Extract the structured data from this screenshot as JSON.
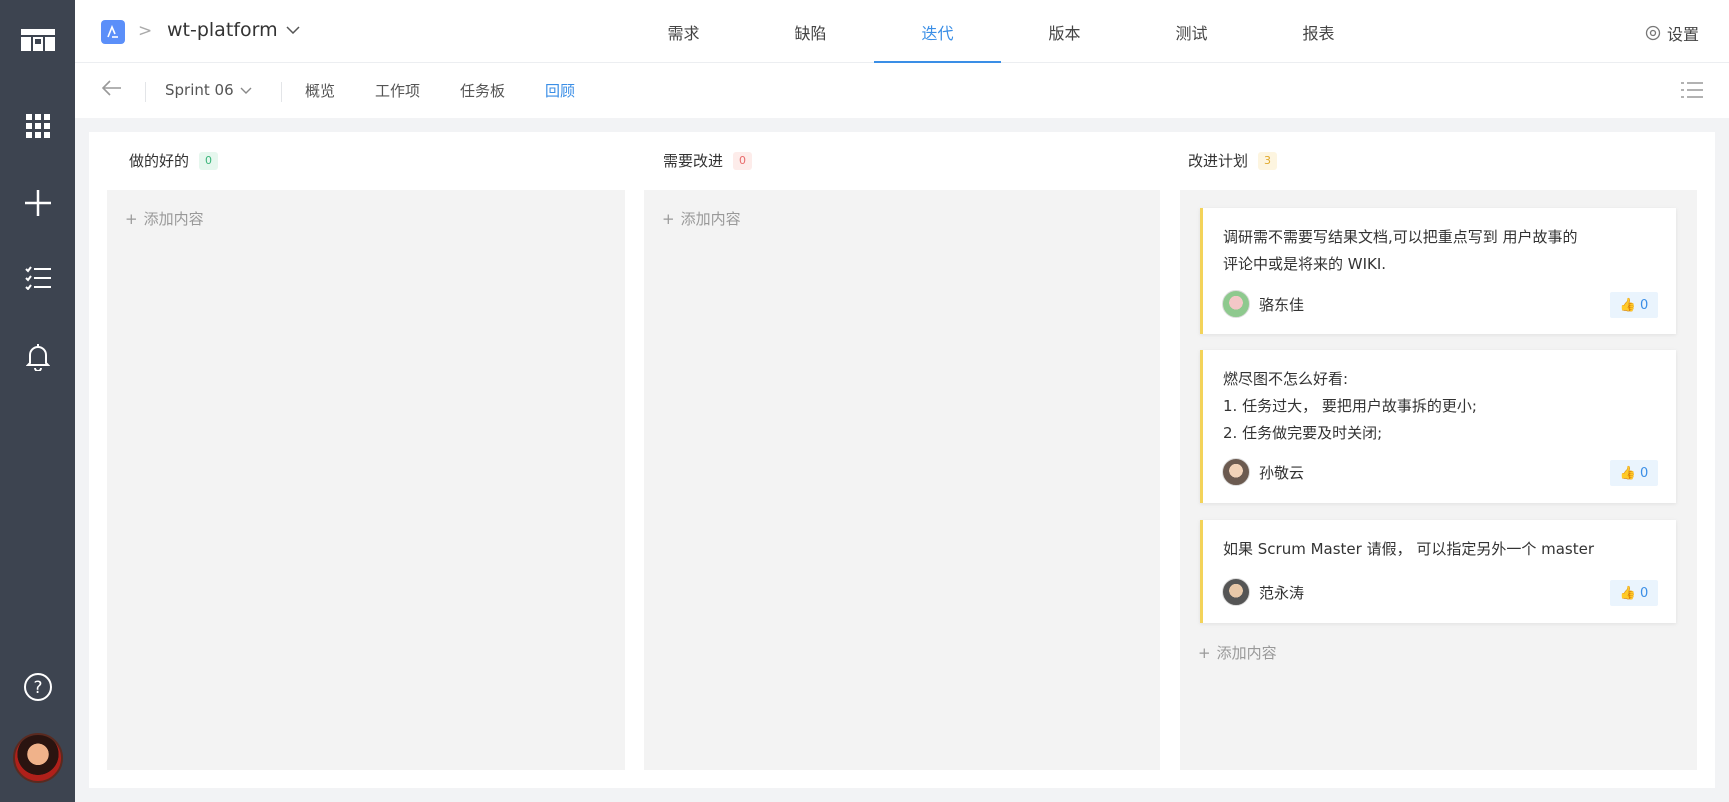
{
  "colors": {
    "accent": "#3a8ee6",
    "sidebar_bg": "#3d4450",
    "card_accent": "#f3d35a"
  },
  "sidebar": {
    "icons": [
      "board-logo-icon",
      "apps-grid-icon",
      "plus-icon",
      "checklist-icon",
      "bell-icon",
      "help-icon"
    ]
  },
  "header": {
    "project_name": "wt-platform",
    "tabs": [
      {
        "label": "需求"
      },
      {
        "label": "缺陷"
      },
      {
        "label": "迭代",
        "active": true
      },
      {
        "label": "版本"
      },
      {
        "label": "测试"
      },
      {
        "label": "报表"
      }
    ],
    "settings_label": "设置"
  },
  "subbar": {
    "sprint": "Sprint 06",
    "tabs": [
      {
        "label": "概览"
      },
      {
        "label": "工作项"
      },
      {
        "label": "任务板"
      },
      {
        "label": "回顾",
        "active": true
      }
    ]
  },
  "board": {
    "add_label": "添加内容",
    "columns": [
      {
        "title": "做的好的",
        "count": "0"
      },
      {
        "title": "需要改进",
        "count": "0"
      },
      {
        "title": "改进计划",
        "count": "3"
      }
    ],
    "cards": [
      {
        "text": "调研需不需要写结果文档,可以把重点写到 用户故事的\n评论中或是将来的 WIKI.",
        "user": "骆东佳",
        "likes": "0"
      },
      {
        "text": "燃尽图不怎么好看:\n1. 任务过大， 要把用户故事拆的更小;\n2. 任务做完要及时关闭;",
        "user": "孙敬云",
        "likes": "0"
      },
      {
        "text": "如果 Scrum Master 请假， 可以指定另外一个 master",
        "user": "范永涛",
        "likes": "0"
      }
    ]
  }
}
